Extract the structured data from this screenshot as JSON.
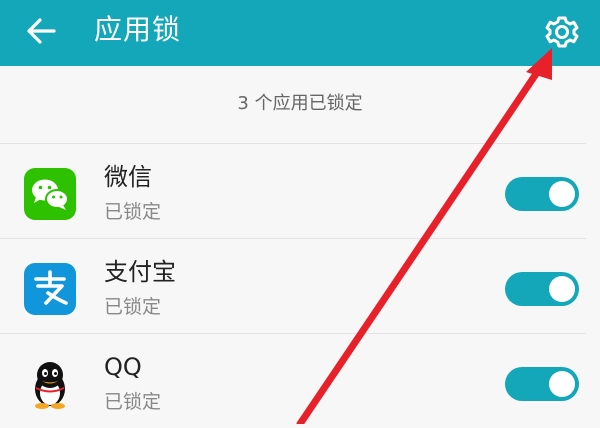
{
  "header": {
    "title": "应用锁",
    "back_icon": "arrow-left-icon",
    "settings_icon": "gear-icon",
    "background": "#13a7b9"
  },
  "summary": "3 个应用已锁定",
  "apps": [
    {
      "name": "微信",
      "status": "已锁定",
      "icon": "wechat-icon",
      "locked": true
    },
    {
      "name": "支付宝",
      "status": "已锁定",
      "icon": "alipay-icon",
      "locked": true
    },
    {
      "name": "QQ",
      "status": "已锁定",
      "icon": "qq-icon",
      "locked": true
    }
  ],
  "colors": {
    "accent": "#13a7b9",
    "annotation": "#e8202a"
  }
}
